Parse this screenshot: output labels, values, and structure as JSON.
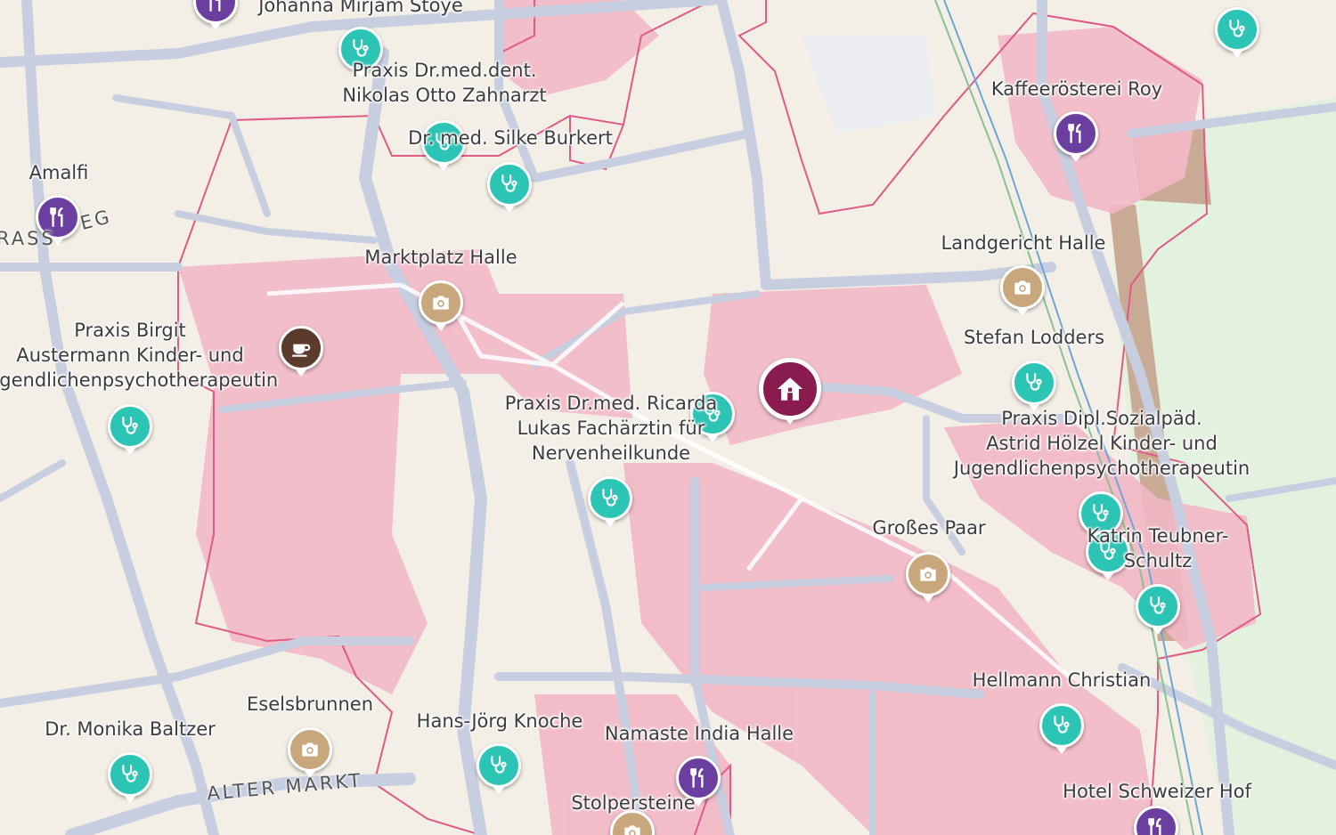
{
  "colors": {
    "medical": "#2cc4b4",
    "restaurant": "#6b3fa0",
    "cafe": "#5a3b2c",
    "sight": "#c9a77c",
    "home": "#8a1b4e",
    "zone_fill": "#f2b8c6",
    "zone_border": "#e05a85",
    "road": "#c6cee0",
    "block": "#f3efe6"
  },
  "pins": [
    {
      "type": "medical",
      "icon": "stethoscope-icon"
    },
    {
      "type": "medical",
      "icon": "stethoscope-icon"
    },
    {
      "type": "medical",
      "icon": "stethoscope-icon"
    },
    {
      "type": "medical",
      "icon": "stethoscope-icon"
    },
    {
      "type": "medical",
      "icon": "stethoscope-icon"
    },
    {
      "type": "medical",
      "icon": "stethoscope-icon"
    },
    {
      "type": "medical",
      "icon": "stethoscope-icon"
    },
    {
      "type": "medical",
      "icon": "stethoscope-icon"
    },
    {
      "type": "medical",
      "icon": "stethoscope-icon"
    },
    {
      "type": "medical",
      "icon": "stethoscope-icon"
    },
    {
      "type": "medical",
      "icon": "stethoscope-icon"
    },
    {
      "type": "medical",
      "icon": "stethoscope-icon"
    },
    {
      "type": "medical",
      "icon": "stethoscope-icon"
    },
    {
      "type": "medical",
      "icon": "stethoscope-icon"
    },
    {
      "type": "restaurant",
      "icon": "fork-knife-icon"
    },
    {
      "type": "restaurant",
      "icon": "fork-knife-icon"
    },
    {
      "type": "restaurant",
      "icon": "fork-knife-icon"
    },
    {
      "type": "restaurant",
      "icon": "fork-knife-icon"
    },
    {
      "type": "restaurant",
      "icon": "fork-knife-icon"
    },
    {
      "type": "cafe",
      "icon": "coffee-cup-icon"
    },
    {
      "type": "sight",
      "icon": "camera-icon"
    },
    {
      "type": "sight",
      "icon": "camera-icon"
    },
    {
      "type": "sight",
      "icon": "camera-icon"
    },
    {
      "type": "sight",
      "icon": "camera-icon"
    },
    {
      "type": "sight",
      "icon": "camera-icon"
    },
    {
      "type": "home",
      "icon": "house-icon"
    }
  ],
  "labels": [
    {
      "text": "Johanna Mirjam Stoye"
    },
    {
      "text": "Praxis Dr.med.dent.\nNikolas Otto Zahnarzt"
    },
    {
      "text": "Dr. med. Silke Burkert"
    },
    {
      "text": "Amalfi"
    },
    {
      "text": "Marktplatz Halle"
    },
    {
      "text": "Praxis Birgit\nAustermann Kinder- und\nJugendlichenpsychotherapeutin"
    },
    {
      "text": "Praxis Dr.med. Ricarda\nLukas Fachärztin für\nNervenheilkunde"
    },
    {
      "text": "Kaffeerösterei Roy"
    },
    {
      "text": "Landgericht Halle"
    },
    {
      "text": "Stefan Lodders"
    },
    {
      "text": "Praxis Dipl.Sozialpäd.\nAstrid Hölzel Kinder- und\nJugendlichenpsychotherapeutin"
    },
    {
      "text": "Großes Paar"
    },
    {
      "text": "Katrin Teubner-\nSchultz"
    },
    {
      "text": "Hellmann Christian"
    },
    {
      "text": "Eselsbrunnen"
    },
    {
      "text": "Dr. Monika Baltzer"
    },
    {
      "text": "Hans-Jörg Knoche"
    },
    {
      "text": "Namaste India Halle"
    },
    {
      "text": "Stolpersteine"
    },
    {
      "text": "Hotel Schweizer Hof"
    }
  ],
  "streets": [
    {
      "text": "ALTER MARKT"
    },
    {
      "text": "RASS"
    },
    {
      "text": "EG"
    }
  ]
}
